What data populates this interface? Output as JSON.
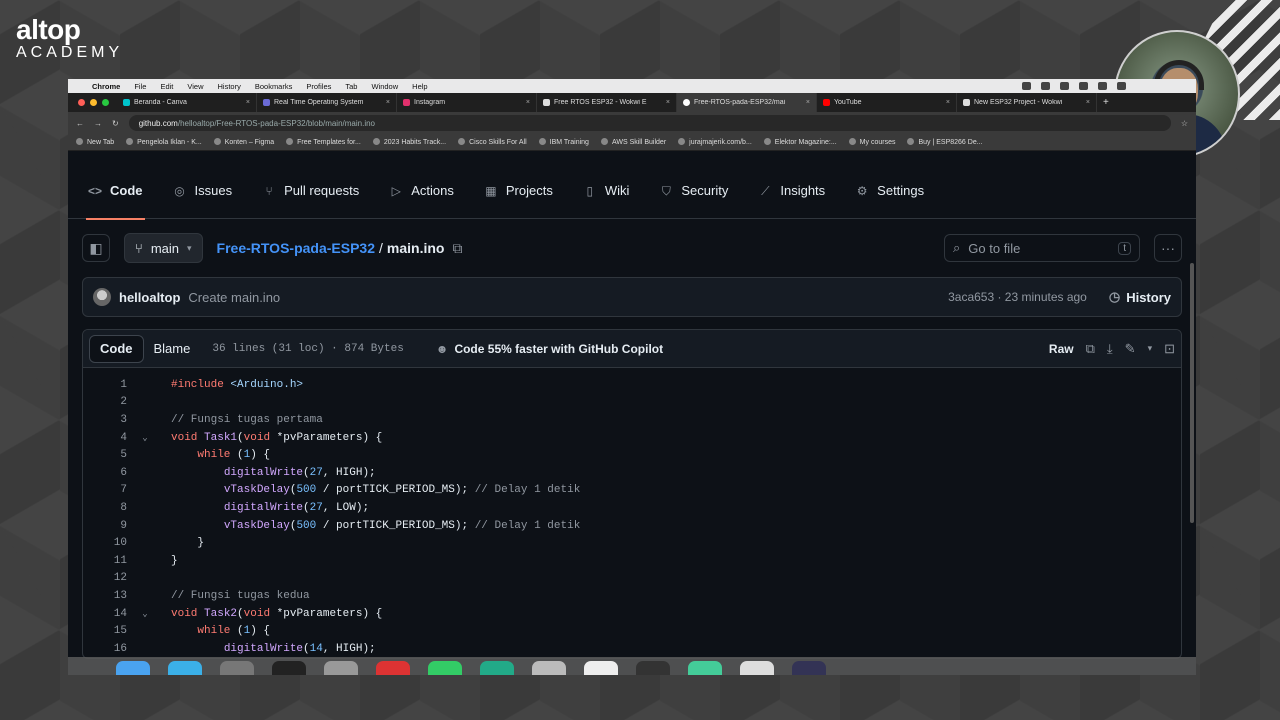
{
  "overlay": {
    "brand_line1": "altop",
    "brand_line2": "ACADEMY"
  },
  "mac_menu": {
    "app": "Chrome",
    "items": [
      "File",
      "Edit",
      "View",
      "History",
      "Bookmarks",
      "Profiles",
      "Tab",
      "Window",
      "Help"
    ]
  },
  "browser": {
    "tabs": [
      {
        "title": "Beranda - Canva",
        "active": false
      },
      {
        "title": "Real Time Operating System",
        "active": false
      },
      {
        "title": "Instagram",
        "active": false
      },
      {
        "title": "Free RTOS ESP32 - Wokwi E",
        "active": false
      },
      {
        "title": "Free-RTOS-pada-ESP32/mai",
        "active": true
      },
      {
        "title": "YouTube",
        "active": false
      },
      {
        "title": "New ESP32 Project - Wokwi",
        "active": false
      }
    ],
    "url_host": "github.com",
    "url_path": "/helloaltop/Free-RTOS-pada-ESP32/blob/main/main.ino",
    "bookmarks": [
      "New Tab",
      "Pengelola Iklan - K...",
      "Konten – Figma",
      "Free Templates for...",
      "2023 Habits Track...",
      "Cisco Skills For All",
      "IBM Training",
      "AWS Skill Builder",
      "jurajmajerik.com/b...",
      "Elektor Magazine:...",
      "My courses",
      "Buy | ESP8266 De..."
    ]
  },
  "repo_nav": [
    {
      "label": "Code",
      "icon": "code-icon",
      "active": true
    },
    {
      "label": "Issues",
      "icon": "issue-icon",
      "active": false
    },
    {
      "label": "Pull requests",
      "icon": "pull-request-icon",
      "active": false
    },
    {
      "label": "Actions",
      "icon": "play-icon",
      "active": false
    },
    {
      "label": "Projects",
      "icon": "table-icon",
      "active": false
    },
    {
      "label": "Wiki",
      "icon": "book-icon",
      "active": false
    },
    {
      "label": "Security",
      "icon": "shield-icon",
      "active": false
    },
    {
      "label": "Insights",
      "icon": "graph-icon",
      "active": false
    },
    {
      "label": "Settings",
      "icon": "gear-icon",
      "active": false
    }
  ],
  "file": {
    "branch": "main",
    "repo": "Free-RTOS-pada-ESP32",
    "separator": "/",
    "filename": "main.ino",
    "search_placeholder": "Go to file",
    "search_key": "t"
  },
  "commit": {
    "user": "helloaltop",
    "message": "Create main.ino",
    "meta": "3aca653 · 23 minutes ago",
    "history_label": "History"
  },
  "viewer": {
    "tab_code": "Code",
    "tab_blame": "Blame",
    "stats": "36 lines (31 loc) · 874 Bytes",
    "copilot": "Code 55% faster with GitHub Copilot",
    "raw_label": "Raw"
  },
  "code_lines": [
    {
      "n": "1",
      "fold": "",
      "html": "<span class=\"kw\">#include</span> <span class=\"inc\">&lt;Arduino.h&gt;</span>"
    },
    {
      "n": "2",
      "fold": "",
      "html": ""
    },
    {
      "n": "3",
      "fold": "",
      "html": "<span class=\"cm\">// Fungsi tugas pertama</span>"
    },
    {
      "n": "4",
      "fold": "v",
      "html": "<span class=\"kw\">void</span> <span class=\"fn\">Task1</span>(<span class=\"kw\">void</span> *pvParameters) {"
    },
    {
      "n": "5",
      "fold": "",
      "html": "    <span class=\"kw\">while</span> (<span class=\"num\">1</span>) {"
    },
    {
      "n": "6",
      "fold": "",
      "html": "        <span class=\"fn\">digitalWrite</span>(<span class=\"num\">27</span>, HIGH);"
    },
    {
      "n": "7",
      "fold": "",
      "html": "        <span class=\"fn\">vTaskDelay</span>(<span class=\"num\">500</span> / portTICK_PERIOD_MS); <span class=\"cm\">// Delay 1 detik</span>"
    },
    {
      "n": "8",
      "fold": "",
      "html": "        <span class=\"fn\">digitalWrite</span>(<span class=\"num\">27</span>, LOW);"
    },
    {
      "n": "9",
      "fold": "",
      "html": "        <span class=\"fn\">vTaskDelay</span>(<span class=\"num\">500</span> / portTICK_PERIOD_MS); <span class=\"cm\">// Delay 1 detik</span>"
    },
    {
      "n": "10",
      "fold": "",
      "html": "    }"
    },
    {
      "n": "11",
      "fold": "",
      "html": "}"
    },
    {
      "n": "12",
      "fold": "",
      "html": ""
    },
    {
      "n": "13",
      "fold": "",
      "html": "<span class=\"cm\">// Fungsi tugas kedua</span>"
    },
    {
      "n": "14",
      "fold": "v",
      "html": "<span class=\"kw\">void</span> <span class=\"fn\">Task2</span>(<span class=\"kw\">void</span> *pvParameters) {"
    },
    {
      "n": "15",
      "fold": "",
      "html": "    <span class=\"kw\">while</span> (<span class=\"num\">1</span>) {"
    },
    {
      "n": "16",
      "fold": "",
      "html": "        <span class=\"fn\">digitalWrite</span>(<span class=\"num\">14</span>, HIGH);"
    }
  ],
  "colors": {
    "accent": "#f78166",
    "link": "#4493f8",
    "bg": "#0d1117"
  }
}
